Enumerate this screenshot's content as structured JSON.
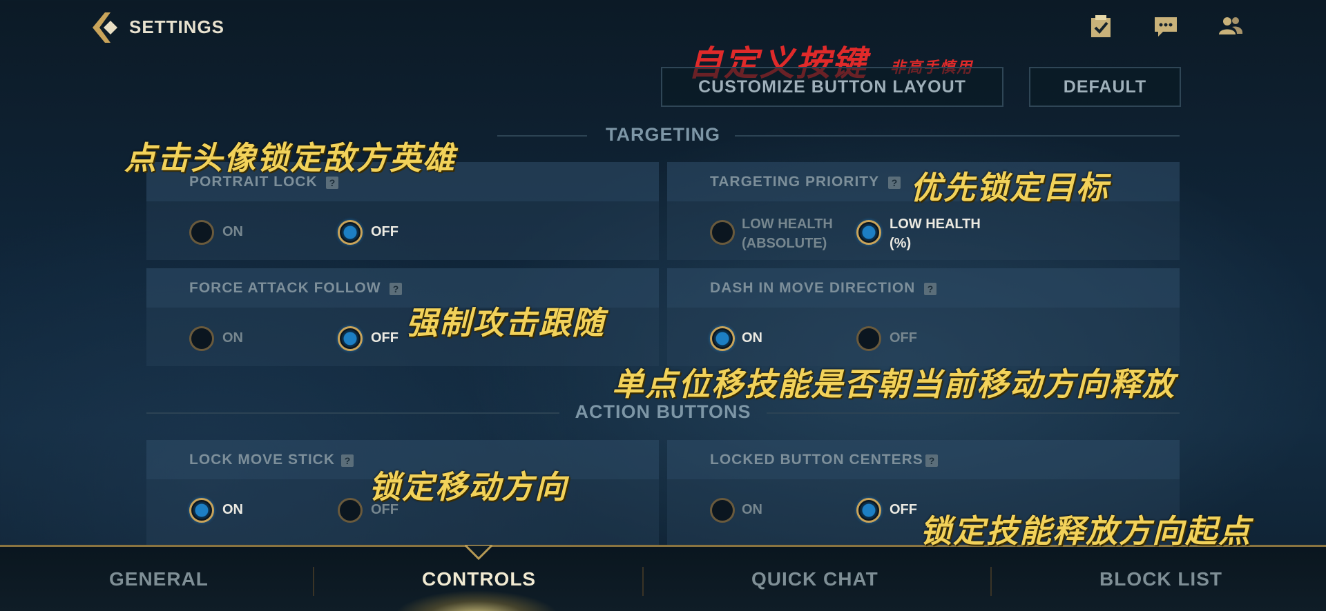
{
  "header": {
    "title": "SETTINGS",
    "icons": [
      "checklist-icon",
      "chat-icon",
      "friends-icon"
    ]
  },
  "actions": {
    "customize_label": "CUSTOMIZE BUTTON LAYOUT",
    "default_label": "DEFAULT"
  },
  "sections": {
    "targeting": "TARGETING",
    "action_buttons": "ACTION BUTTONS"
  },
  "options": {
    "portrait_lock": {
      "label": "PORTRAIT LOCK",
      "help": "?",
      "opt1": "ON",
      "opt2": "OFF",
      "selected": "OFF"
    },
    "targeting_priority": {
      "label": "TARGETING PRIORITY",
      "help": "?",
      "opt1_line1": "LOW HEALTH",
      "opt1_line2": "(ABSOLUTE)",
      "opt2_line1": "LOW HEALTH",
      "opt2_line2": "(%)",
      "selected": "LOW HEALTH (%)"
    },
    "force_attack_follow": {
      "label": "FORCE ATTACK FOLLOW",
      "help": "?",
      "opt1": "ON",
      "opt2": "OFF",
      "selected": "OFF"
    },
    "dash_in_move_direction": {
      "label": "DASH IN MOVE DIRECTION",
      "help": "?",
      "opt1": "ON",
      "opt2": "OFF",
      "selected": "ON"
    },
    "lock_move_stick": {
      "label": "LOCK MOVE STICK",
      "help": "?",
      "opt1": "ON",
      "opt2": "OFF",
      "selected": "ON"
    },
    "locked_button_centers": {
      "label": "LOCKED BUTTON CENTERS",
      "help": "?",
      "opt1": "ON",
      "opt2": "OFF",
      "selected": "OFF"
    }
  },
  "annotations": {
    "customize_main": "自定义按键",
    "customize_sub": "非高手慎用",
    "portrait": "点击头像锁定敌方英雄",
    "priority": "优先锁定目标",
    "force": "强制攻击跟随",
    "dash": "单点位移技能是否朝当前移动方向释放",
    "lockmove": "锁定移动方向",
    "lockcenter": "锁定技能释放方向起点"
  },
  "nav": {
    "tabs": [
      "GENERAL",
      "CONTROLS",
      "QUICK CHAT",
      "BLOCK LIST"
    ],
    "active": "CONTROLS"
  },
  "colors": {
    "accent_gold": "#c9a45a",
    "radio_selected_blue": "#1d7fc4",
    "annotation_yellow": "#f2d25a",
    "annotation_red": "#e02a2a"
  }
}
